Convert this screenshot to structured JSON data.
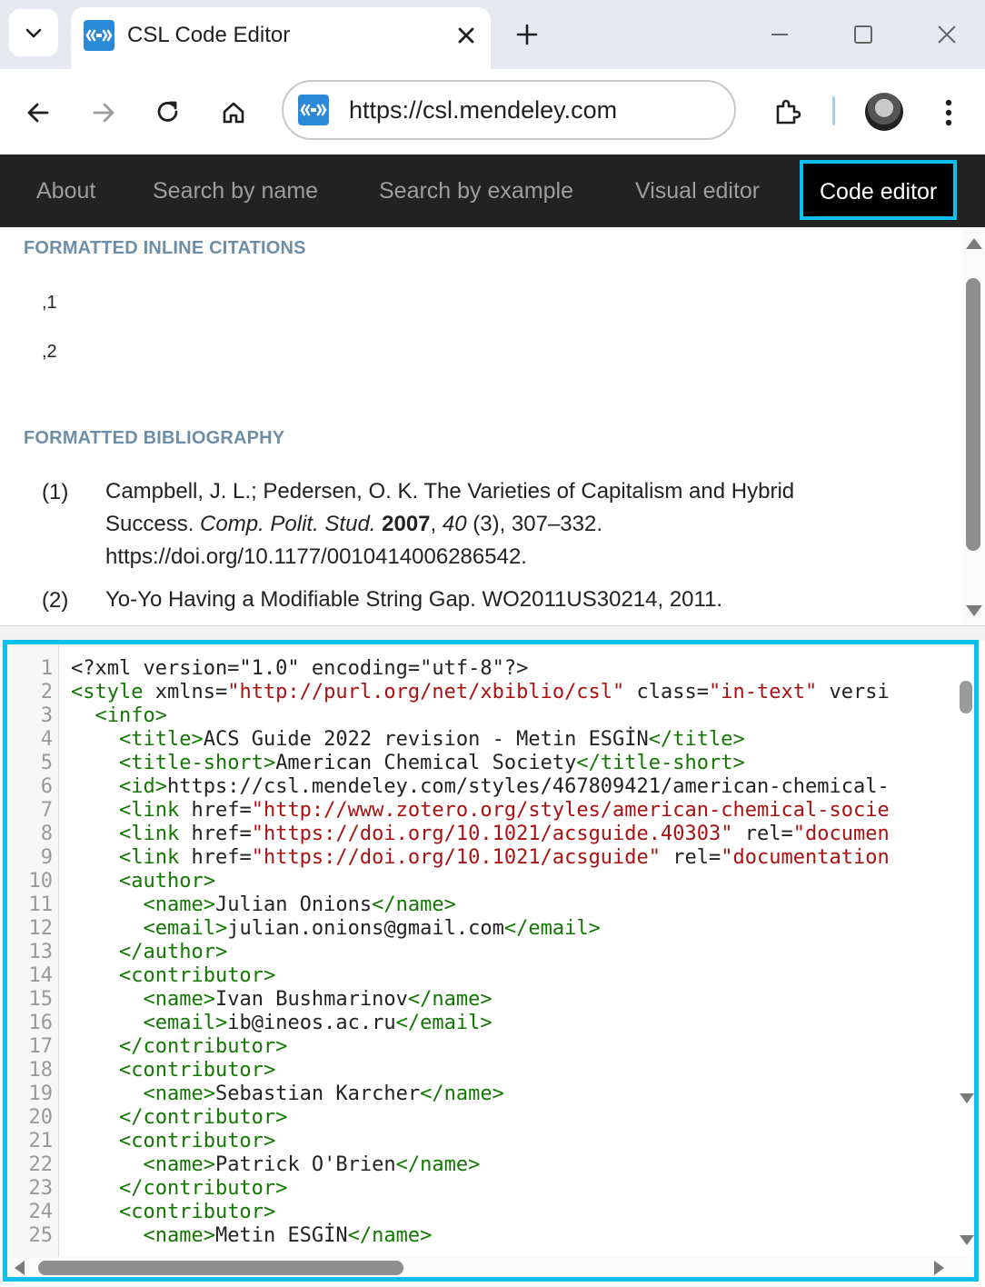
{
  "browser": {
    "tab_title": "CSL Code Editor",
    "url": "https://csl.mendeley.com",
    "accent_color": "#0bbfef"
  },
  "nav": {
    "items": [
      {
        "label": "About"
      },
      {
        "label": "Search by name"
      },
      {
        "label": "Search by example"
      },
      {
        "label": "Visual editor"
      },
      {
        "label": "Code editor",
        "active": true
      }
    ]
  },
  "output": {
    "inline_heading": "FORMATTED INLINE CITATIONS",
    "citations": [
      ",1",
      ",2"
    ],
    "bib_heading": "FORMATTED BIBLIOGRAPHY",
    "bibliography": [
      {
        "num": "(1)",
        "authors": "Campbell, J. L.; Pedersen, O. K. The Varieties of Capitalism and Hybrid Success.",
        "journal": "Comp. Polit. Stud.",
        "year": "2007",
        "volume": "40",
        "rest": "(3), 307–332. https://doi.org/10.1177/0010414006286542."
      },
      {
        "num": "(2)",
        "text": "Yo-Yo Having a Modifiable String Gap. WO2011US30214, 2011."
      }
    ]
  },
  "editor": {
    "line_numbers": [
      "1",
      "2",
      "3",
      "4",
      "5",
      "6",
      "7",
      "8",
      "9",
      "10",
      "11",
      "12",
      "13",
      "14",
      "15",
      "16",
      "17",
      "18",
      "19",
      "20",
      "21",
      "22",
      "23",
      "24",
      "25"
    ],
    "lines": [
      "<?xml version=\"1.0\" encoding=\"utf-8\"?>",
      "<style xmlns=\"http://purl.org/net/xbiblio/csl\" class=\"in-text\" versi",
      "  <info>",
      "    <title>ACS Guide 2022 revision - Metin ESGİN</title>",
      "    <title-short>American Chemical Society</title-short>",
      "    <id>https://csl.mendeley.com/styles/467809421/american-chemical-",
      "    <link href=\"http://www.zotero.org/styles/american-chemical-socie",
      "    <link href=\"https://doi.org/10.1021/acsguide.40303\" rel=\"documen",
      "    <link href=\"https://doi.org/10.1021/acsguide\" rel=\"documentation",
      "    <author>",
      "      <name>Julian Onions</name>",
      "      <email>julian.onions@gmail.com</email>",
      "    </author>",
      "    <contributor>",
      "      <name>Ivan Bushmarinov</name>",
      "      <email>ib@ineos.ac.ru</email>",
      "    </contributor>",
      "    <contributor>",
      "      <name>Sebastian Karcher</name>",
      "    </contributor>",
      "    <contributor>",
      "      <name>Patrick O'Brien</name>",
      "    </contributor>",
      "    <contributor>",
      "      <name>Metin ESGİN</name>"
    ]
  }
}
